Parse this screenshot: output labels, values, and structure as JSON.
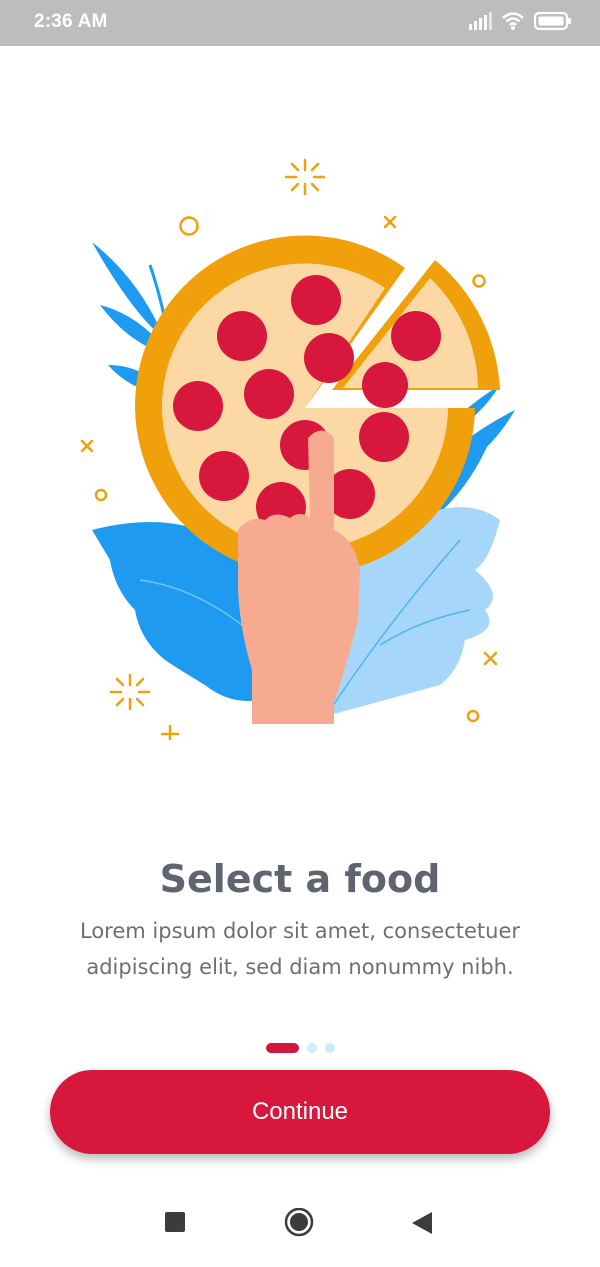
{
  "status_bar": {
    "time": "2:36 AM",
    "icons": [
      "signal-icon",
      "wifi-icon",
      "battery-icon"
    ]
  },
  "onboarding": {
    "illustration": "pizza-hand-illustration",
    "title": "Select a food",
    "description": "Lorem ipsum dolor sit amet, consectetuer adipiscing elit, sed diam nonummy nibh.",
    "page_indicator": {
      "current": 1,
      "total": 3
    }
  },
  "actions": {
    "continue_label": "Continue"
  },
  "nav_bar": {
    "buttons": [
      "recents-square-icon",
      "home-circle-icon",
      "back-triangle-icon"
    ]
  },
  "colors": {
    "accent": "#d7173c",
    "pizza_crust": "#f0a00a",
    "pizza_cheese": "#fcd9a4",
    "pepperoni": "#d7173c",
    "leaf_dark": "#1e9bf0",
    "leaf_light": "#9fd3fa",
    "hand": "#f6ab91"
  }
}
